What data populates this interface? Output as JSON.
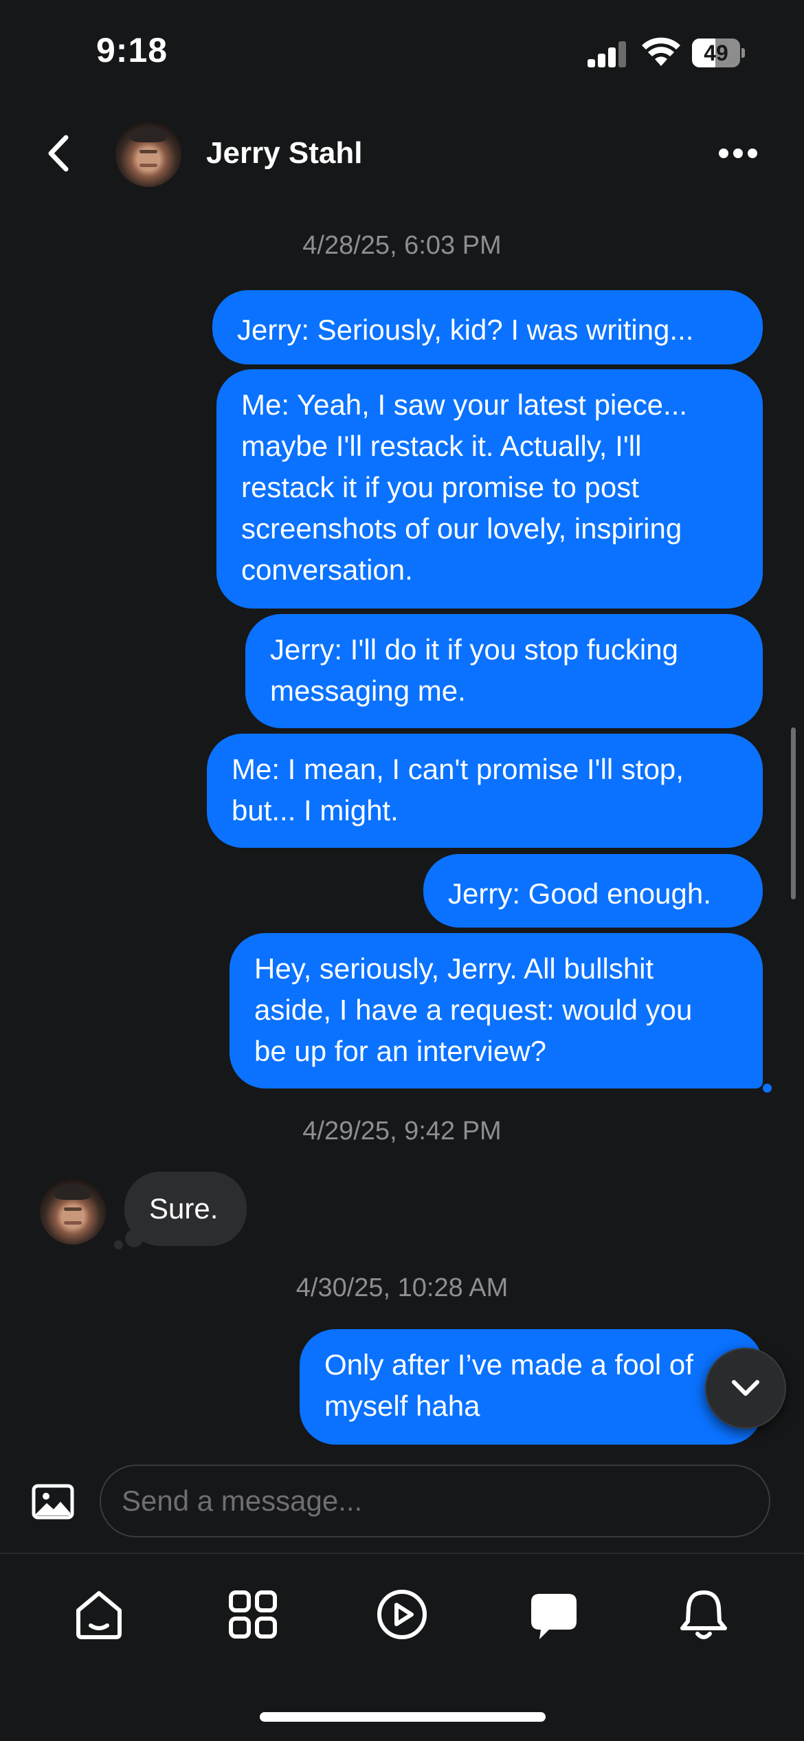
{
  "status_bar": {
    "time": "9:18",
    "battery": "49",
    "battery_fraction": 0.49
  },
  "header": {
    "contact_name": "Jerry Stahl",
    "back_icon": "chevron-left-icon",
    "more_icon": "more-horizontal-icon"
  },
  "conversation": {
    "timestamps": [
      "4/28/25, 6:03 PM",
      "4/29/25, 9:42 PM",
      "4/30/25, 10:28 AM"
    ],
    "outgoing": [
      {
        "lines": [
          "Jerry: Seriously, kid? I was writing..."
        ]
      },
      {
        "lines": [
          "Me: Yeah, I saw your latest piece...",
          "maybe I'll restack it. Actually, I'll",
          "restack it if you promise to post",
          "screenshots of our lovely, inspiring",
          "conversation."
        ]
      },
      {
        "lines": [
          "Jerry: I'll do it if you stop fucking",
          "messaging me."
        ]
      },
      {
        "lines": [
          "Me: I mean, I can't promise I'll stop,",
          "but... I might."
        ]
      },
      {
        "lines": [
          "Jerry: Good enough."
        ]
      },
      {
        "lines": [
          "Hey, seriously, Jerry. All bullshit",
          "aside, I have a request: would you",
          "be up for an interview?"
        ]
      },
      {
        "lines": [
          "Only after I’ve made a fool of",
          "myself haha"
        ]
      }
    ],
    "incoming": [
      {
        "text": "Sure."
      }
    ]
  },
  "composer": {
    "placeholder": "Send a message...",
    "value": ""
  },
  "tab_bar": {
    "tabs": [
      {
        "name": "home-icon"
      },
      {
        "name": "grid-icon"
      },
      {
        "name": "play-icon"
      },
      {
        "name": "chat-icon"
      },
      {
        "name": "bell-icon"
      }
    ]
  },
  "colors": {
    "outgoing_bubble": "#0a72ff",
    "incoming_bubble": "#2c2d2f",
    "background": "#161718",
    "timestamp": "#8e8e93"
  }
}
